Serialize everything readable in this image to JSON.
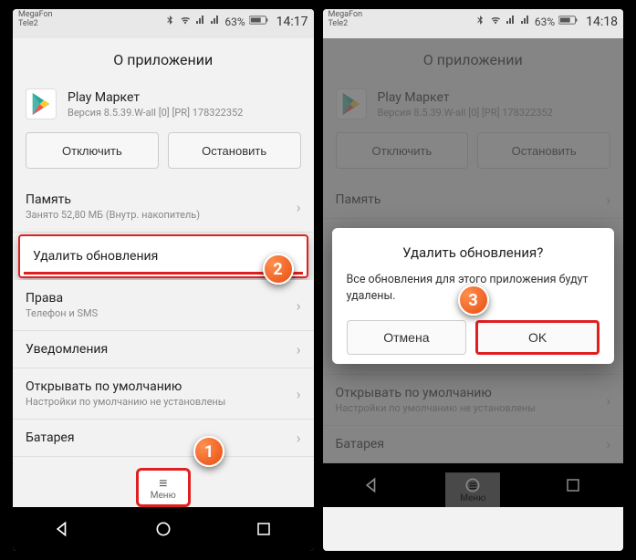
{
  "left": {
    "status": {
      "carrier1": "MegaFon",
      "carrier2": "Tele2",
      "battery": "63%",
      "time": "14:17"
    },
    "title": "О приложении",
    "app": {
      "name": "Play Маркет",
      "version": "Версия 8.5.39.W-all [0] [PR] 178322352"
    },
    "buttons": {
      "disable": "Отключить",
      "stop": "Остановить"
    },
    "rows": {
      "memory": {
        "title": "Память",
        "sub": "Занято 52,80 МБ (Внутр. накопитель)"
      },
      "delete_updates": {
        "title": "Удалить обновления"
      },
      "rights": {
        "title": "Права",
        "sub": "Телефон и SMS"
      },
      "notifications": {
        "title": "Уведомления"
      },
      "defaults": {
        "title": "Открывать по умолчанию",
        "sub": "Настройки по умолчанию не установлены"
      },
      "battery": {
        "title": "Батарея"
      }
    },
    "menu": {
      "label": "Меню"
    },
    "callouts": {
      "c1": "1",
      "c2": "2"
    }
  },
  "right": {
    "status": {
      "carrier1": "MegaFon",
      "carrier2": "Tele2",
      "battery": "63%",
      "time": "14:18"
    },
    "title": "О приложении",
    "app": {
      "name": "Play Маркет",
      "version": "Версия 8.5.39.W-all [0] [PR] 178322352"
    },
    "buttons": {
      "disable": "Отключить",
      "stop": "Остановить"
    },
    "rows": {
      "memory": {
        "title": "Память",
        "sub": ""
      },
      "notifications": {
        "title": "Уведомления"
      },
      "defaults": {
        "title": "Открывать по умолчанию",
        "sub": "Настройки по умолчанию не установлены"
      },
      "battery": {
        "title": "Батарея"
      }
    },
    "dialog": {
      "title": "Удалить обновления?",
      "message": "Все обновления для этого приложения будут удалены.",
      "cancel": "Отмена",
      "ok": "OK"
    },
    "menu": {
      "label": "Меню"
    },
    "callouts": {
      "c3": "3"
    }
  }
}
